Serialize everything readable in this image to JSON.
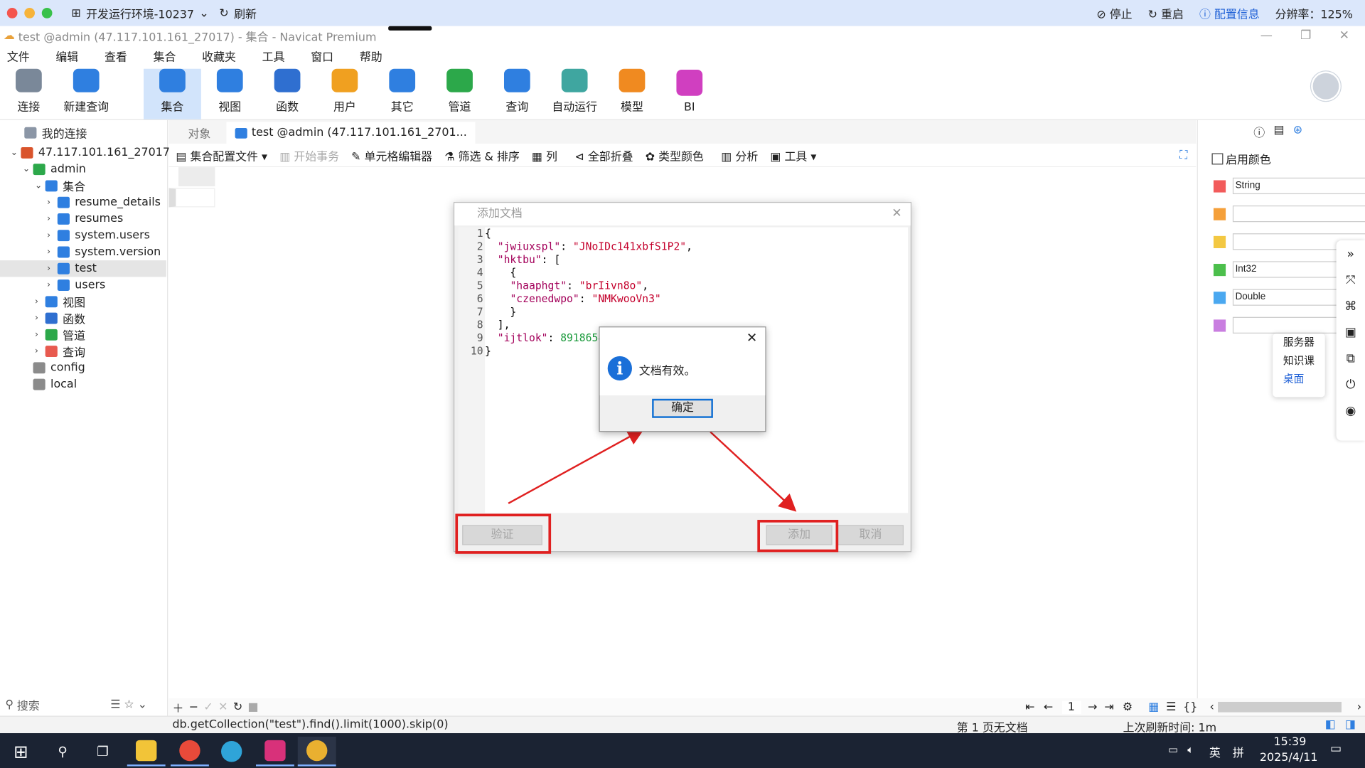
{
  "host": {
    "env_label": "开发运行环境-10237",
    "refresh": "刷新",
    "stop": "停止",
    "restart": "重启",
    "config_info": "配置信息",
    "resolution": "分辨率：125%"
  },
  "window": {
    "title": "test @admin (47.117.101.161_27017) - 集合 - Navicat Premium"
  },
  "menu": [
    "文件",
    "编辑",
    "查看",
    "集合",
    "收藏夹",
    "工具",
    "窗口",
    "帮助"
  ],
  "toolbar": [
    {
      "label": "连接",
      "color": "#7a8899"
    },
    {
      "label": "新建查询",
      "color": "#2f7fe0"
    },
    {
      "label": "集合",
      "color": "#2f7fe0"
    },
    {
      "label": "视图",
      "color": "#2f7fe0"
    },
    {
      "label": "函数",
      "color": "#2f6fd0"
    },
    {
      "label": "用户",
      "color": "#f0a020"
    },
    {
      "label": "其它",
      "color": "#2f7fe0"
    },
    {
      "label": "管道",
      "color": "#2ca84a"
    },
    {
      "label": "查询",
      "color": "#2f7fe0"
    },
    {
      "label": "自动运行",
      "color": "#3fa6a0"
    },
    {
      "label": "模型",
      "color": "#f08a20"
    },
    {
      "label": "BI",
      "color": "#d03fc0"
    }
  ],
  "tree": {
    "root": "我的连接",
    "connection": "47.117.101.161_27017",
    "db": "admin",
    "collections_label": "集合",
    "collections": [
      "resume_details",
      "resumes",
      "system.users",
      "system.version",
      "test",
      "users"
    ],
    "groups": [
      "视图",
      "函数",
      "管道",
      "查询"
    ],
    "other_dbs": [
      "config",
      "local"
    ]
  },
  "left_search": "搜索",
  "tabs": {
    "objects": "对象",
    "active": "test @admin (47.117.101.161_2701..."
  },
  "subtoolbar": {
    "profile": "集合配置文件",
    "begin_tx": "开始事务",
    "cell_editor": "单元格编辑器",
    "filter_sort": "筛选 & 排序",
    "columns": "列",
    "collapse_all": "全部折叠",
    "type_color": "类型颜色",
    "analyze": "分析",
    "tools": "工具"
  },
  "right_panel": {
    "enable_color": "启用颜色",
    "types": [
      {
        "color": "#f25b5b",
        "value": "String"
      },
      {
        "color": "#f5a03a",
        "value": ""
      },
      {
        "color": "#f3c842",
        "value": ""
      },
      {
        "color": "#4cbf4c",
        "value": "Int32"
      },
      {
        "color": "#4aa8f0",
        "value": "Double"
      },
      {
        "color": "#c97ee0",
        "value": ""
      }
    ]
  },
  "popmenu": [
    "服务器",
    "知识课",
    "桌面"
  ],
  "dialog": {
    "title": "添加文档",
    "code": [
      {
        "n": "1",
        "text": "{"
      },
      {
        "n": "2",
        "key": "\"jwiuxspl\"",
        "val": "\"JNoIDc141xbfS1P2\"",
        "tail": ","
      },
      {
        "n": "3",
        "key": "\"hktbu\"",
        "tail": ": ["
      },
      {
        "n": "4",
        "text": "    {"
      },
      {
        "n": "5",
        "key": "\"haaphgt\"",
        "val": "\"brIivn8o\"",
        "tail": ","
      },
      {
        "n": "6",
        "key": "\"czenedwpo\"",
        "val": "\"NMKwooVn3\"",
        "tail": ""
      },
      {
        "n": "7",
        "text": "    }"
      },
      {
        "n": "8",
        "text": "  ],"
      },
      {
        "n": "9",
        "key": "\"ijtlok\"",
        "num": "8918654",
        "tail": ""
      },
      {
        "n": "10",
        "text": "}"
      }
    ],
    "validate": "验证",
    "add": "添加",
    "cancel": "取消"
  },
  "message": {
    "text": "文档有效。",
    "ok": "确定"
  },
  "nav": {
    "page": "1"
  },
  "status": {
    "query": "db.getCollection(\"test\").find().limit(1000).skip(0)",
    "pageinfo": "第 1 页无文档",
    "refresh": "上次刷新时间: 1m"
  },
  "taskbar": {
    "time": "15:39",
    "date": "2025/4/11",
    "ime1": "英",
    "ime2": "拼"
  }
}
